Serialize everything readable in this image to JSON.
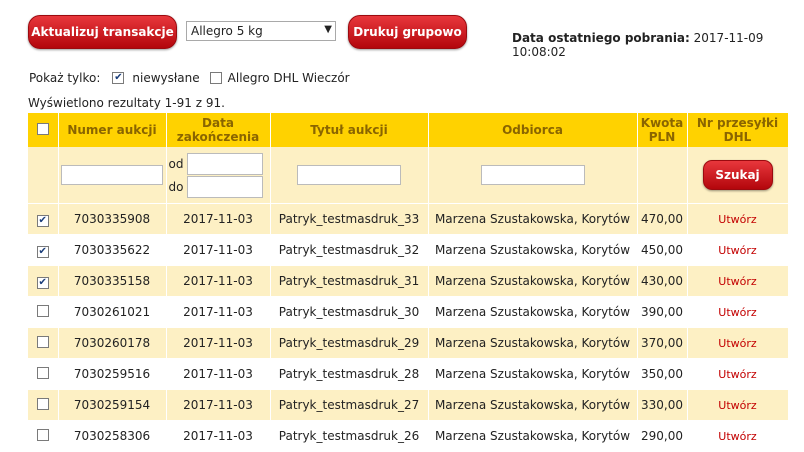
{
  "toolbar": {
    "update_label": "Aktualizuj transakcje",
    "shipping_select": "Allegro 5 kg",
    "print_label": "Drukuj grupowo",
    "last_fetch_label": "Data ostatniego pobrania:",
    "last_fetch_value": "2017-11-09 10:08:02"
  },
  "filters": {
    "show_only_label": "Pokaż tylko:",
    "unsent_label": "niewysłane",
    "unsent_checked": true,
    "dhl_label": "Allegro DHL Wieczór",
    "dhl_checked": false
  },
  "results_text": "Wyświetlono rezultaty 1-91 z 91.",
  "table": {
    "headers": [
      "Numer aukcji",
      "Data zakończenia",
      "Tytuł aukcji",
      "Odbiorca",
      "Kwota PLN",
      "Nr przesyłki DHL"
    ],
    "from_label": "od",
    "to_label": "do",
    "search_label": "Szukaj",
    "rows": [
      {
        "auction": "7030335908",
        "date": "2017-11-03",
        "title": "Patryk_testmasdruk_33",
        "recipient": "Marzena Szustakowska, Korytów",
        "amount": "470,00",
        "action": "Utwórz",
        "checked": true
      },
      {
        "auction": "7030335622",
        "date": "2017-11-03",
        "title": "Patryk_testmasdruk_32",
        "recipient": "Marzena Szustakowska, Korytów",
        "amount": "450,00",
        "action": "Utwórz",
        "checked": true
      },
      {
        "auction": "7030335158",
        "date": "2017-11-03",
        "title": "Patryk_testmasdruk_31",
        "recipient": "Marzena Szustakowska, Korytów",
        "amount": "430,00",
        "action": "Utwórz",
        "checked": true
      },
      {
        "auction": "7030261021",
        "date": "2017-11-03",
        "title": "Patryk_testmasdruk_30",
        "recipient": "Marzena Szustakowska, Korytów",
        "amount": "390,00",
        "action": "Utwórz",
        "checked": false
      },
      {
        "auction": "7030260178",
        "date": "2017-11-03",
        "title": "Patryk_testmasdruk_29",
        "recipient": "Marzena Szustakowska, Korytów",
        "amount": "370,00",
        "action": "Utwórz",
        "checked": false
      },
      {
        "auction": "7030259516",
        "date": "2017-11-03",
        "title": "Patryk_testmasdruk_28",
        "recipient": "Marzena Szustakowska, Korytów",
        "amount": "350,00",
        "action": "Utwórz",
        "checked": false
      },
      {
        "auction": "7030259154",
        "date": "2017-11-03",
        "title": "Patryk_testmasdruk_27",
        "recipient": "Marzena Szustakowska, Korytów",
        "amount": "330,00",
        "action": "Utwórz",
        "checked": false
      },
      {
        "auction": "7030258306",
        "date": "2017-11-03",
        "title": "Patryk_testmasdruk_26",
        "recipient": "Marzena Szustakowska, Korytów",
        "amount": "290,00",
        "action": "Utwórz",
        "checked": false
      }
    ]
  }
}
